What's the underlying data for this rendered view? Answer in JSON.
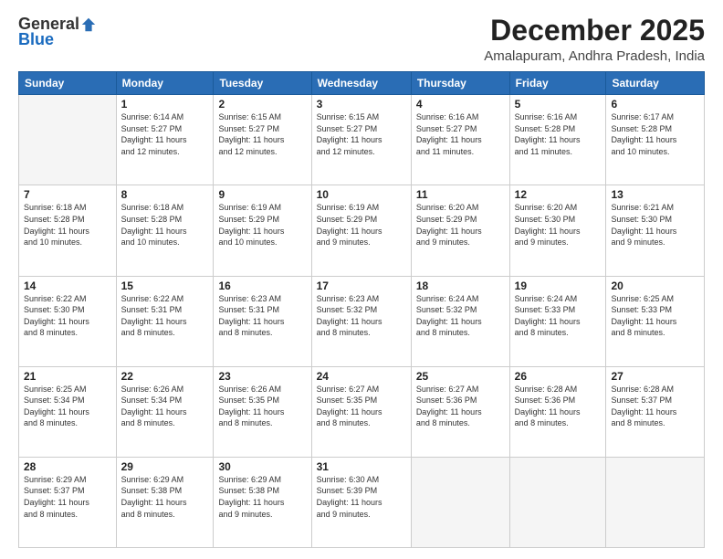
{
  "logo": {
    "general": "General",
    "blue": "Blue"
  },
  "title": "December 2025",
  "location": "Amalapuram, Andhra Pradesh, India",
  "days_header": [
    "Sunday",
    "Monday",
    "Tuesday",
    "Wednesday",
    "Thursday",
    "Friday",
    "Saturday"
  ],
  "weeks": [
    [
      {
        "day": "",
        "info": ""
      },
      {
        "day": "1",
        "info": "Sunrise: 6:14 AM\nSunset: 5:27 PM\nDaylight: 11 hours\nand 12 minutes."
      },
      {
        "day": "2",
        "info": "Sunrise: 6:15 AM\nSunset: 5:27 PM\nDaylight: 11 hours\nand 12 minutes."
      },
      {
        "day": "3",
        "info": "Sunrise: 6:15 AM\nSunset: 5:27 PM\nDaylight: 11 hours\nand 12 minutes."
      },
      {
        "day": "4",
        "info": "Sunrise: 6:16 AM\nSunset: 5:27 PM\nDaylight: 11 hours\nand 11 minutes."
      },
      {
        "day": "5",
        "info": "Sunrise: 6:16 AM\nSunset: 5:28 PM\nDaylight: 11 hours\nand 11 minutes."
      },
      {
        "day": "6",
        "info": "Sunrise: 6:17 AM\nSunset: 5:28 PM\nDaylight: 11 hours\nand 10 minutes."
      }
    ],
    [
      {
        "day": "7",
        "info": "Sunrise: 6:18 AM\nSunset: 5:28 PM\nDaylight: 11 hours\nand 10 minutes."
      },
      {
        "day": "8",
        "info": "Sunrise: 6:18 AM\nSunset: 5:28 PM\nDaylight: 11 hours\nand 10 minutes."
      },
      {
        "day": "9",
        "info": "Sunrise: 6:19 AM\nSunset: 5:29 PM\nDaylight: 11 hours\nand 10 minutes."
      },
      {
        "day": "10",
        "info": "Sunrise: 6:19 AM\nSunset: 5:29 PM\nDaylight: 11 hours\nand 9 minutes."
      },
      {
        "day": "11",
        "info": "Sunrise: 6:20 AM\nSunset: 5:29 PM\nDaylight: 11 hours\nand 9 minutes."
      },
      {
        "day": "12",
        "info": "Sunrise: 6:20 AM\nSunset: 5:30 PM\nDaylight: 11 hours\nand 9 minutes."
      },
      {
        "day": "13",
        "info": "Sunrise: 6:21 AM\nSunset: 5:30 PM\nDaylight: 11 hours\nand 9 minutes."
      }
    ],
    [
      {
        "day": "14",
        "info": "Sunrise: 6:22 AM\nSunset: 5:30 PM\nDaylight: 11 hours\nand 8 minutes."
      },
      {
        "day": "15",
        "info": "Sunrise: 6:22 AM\nSunset: 5:31 PM\nDaylight: 11 hours\nand 8 minutes."
      },
      {
        "day": "16",
        "info": "Sunrise: 6:23 AM\nSunset: 5:31 PM\nDaylight: 11 hours\nand 8 minutes."
      },
      {
        "day": "17",
        "info": "Sunrise: 6:23 AM\nSunset: 5:32 PM\nDaylight: 11 hours\nand 8 minutes."
      },
      {
        "day": "18",
        "info": "Sunrise: 6:24 AM\nSunset: 5:32 PM\nDaylight: 11 hours\nand 8 minutes."
      },
      {
        "day": "19",
        "info": "Sunrise: 6:24 AM\nSunset: 5:33 PM\nDaylight: 11 hours\nand 8 minutes."
      },
      {
        "day": "20",
        "info": "Sunrise: 6:25 AM\nSunset: 5:33 PM\nDaylight: 11 hours\nand 8 minutes."
      }
    ],
    [
      {
        "day": "21",
        "info": "Sunrise: 6:25 AM\nSunset: 5:34 PM\nDaylight: 11 hours\nand 8 minutes."
      },
      {
        "day": "22",
        "info": "Sunrise: 6:26 AM\nSunset: 5:34 PM\nDaylight: 11 hours\nand 8 minutes."
      },
      {
        "day": "23",
        "info": "Sunrise: 6:26 AM\nSunset: 5:35 PM\nDaylight: 11 hours\nand 8 minutes."
      },
      {
        "day": "24",
        "info": "Sunrise: 6:27 AM\nSunset: 5:35 PM\nDaylight: 11 hours\nand 8 minutes."
      },
      {
        "day": "25",
        "info": "Sunrise: 6:27 AM\nSunset: 5:36 PM\nDaylight: 11 hours\nand 8 minutes."
      },
      {
        "day": "26",
        "info": "Sunrise: 6:28 AM\nSunset: 5:36 PM\nDaylight: 11 hours\nand 8 minutes."
      },
      {
        "day": "27",
        "info": "Sunrise: 6:28 AM\nSunset: 5:37 PM\nDaylight: 11 hours\nand 8 minutes."
      }
    ],
    [
      {
        "day": "28",
        "info": "Sunrise: 6:29 AM\nSunset: 5:37 PM\nDaylight: 11 hours\nand 8 minutes."
      },
      {
        "day": "29",
        "info": "Sunrise: 6:29 AM\nSunset: 5:38 PM\nDaylight: 11 hours\nand 8 minutes."
      },
      {
        "day": "30",
        "info": "Sunrise: 6:29 AM\nSunset: 5:38 PM\nDaylight: 11 hours\nand 9 minutes."
      },
      {
        "day": "31",
        "info": "Sunrise: 6:30 AM\nSunset: 5:39 PM\nDaylight: 11 hours\nand 9 minutes."
      },
      {
        "day": "",
        "info": ""
      },
      {
        "day": "",
        "info": ""
      },
      {
        "day": "",
        "info": ""
      }
    ]
  ]
}
